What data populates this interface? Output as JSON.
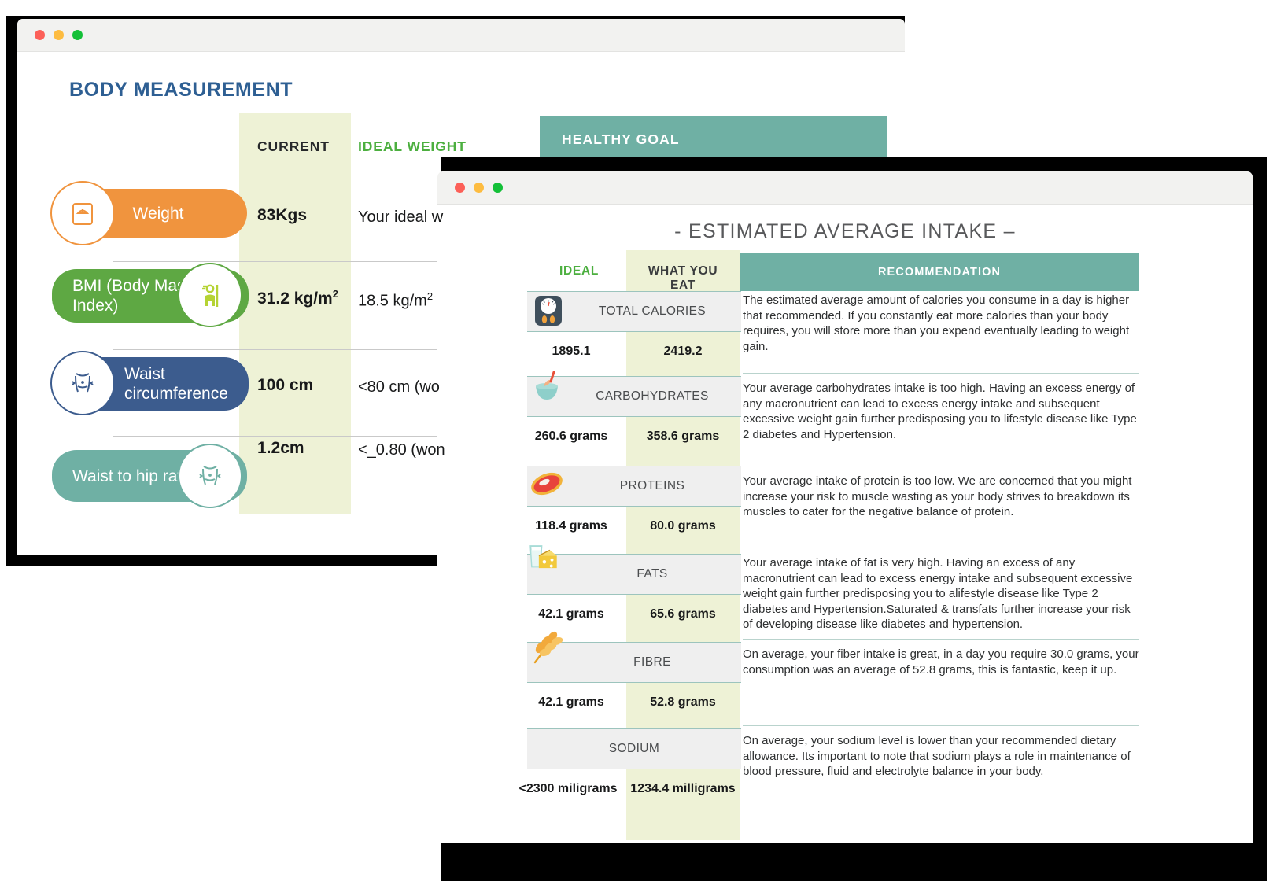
{
  "window1": {
    "traffic_lights": [
      "close",
      "minimize",
      "maximize"
    ],
    "title": "BODY MEASUREMENT",
    "columns": {
      "current": "CURRENT",
      "ideal_weight": "IDEAL WEIGHT",
      "healthy_goal": "HEALTHY GOAL"
    },
    "colors": {
      "title": "#2e5f93",
      "current_strip": "#eef2d6",
      "ideal_header": "#4caf3f",
      "healthy_goal_bar": "#6fb0a4"
    },
    "rows": [
      {
        "label": "Weight",
        "icon": "weighing-scale-icon",
        "pill_color": "#f0943e",
        "current": "83Kgs",
        "ideal": "Your ideal w"
      },
      {
        "label": "BMI (Body Mass Index)",
        "icon": "body-height-person-icon",
        "pill_color": "#5ea843",
        "current": "31.2 kg/m",
        "current_sup": "2",
        "ideal": "18.5 kg/m",
        "ideal_sup": "2-"
      },
      {
        "label": "Waist circumference",
        "icon": "waist-measure-icon",
        "pill_color": "#3c5c8e",
        "current": "100 cm",
        "ideal": "<80 cm (wo"
      },
      {
        "label": "Waist to hip ratio",
        "icon": "waist-hip-icon",
        "pill_color": "#6fb0a4",
        "current": "1.2cm",
        "ideal": "<_0.80 (won"
      }
    ]
  },
  "window2": {
    "traffic_lights": [
      "close",
      "minimize",
      "maximize"
    ],
    "title": "- ESTIMATED AVERAGE INTAKE –",
    "columns": {
      "ideal": "IDEAL",
      "what_you_eat": "WHAT YOU EAT",
      "recommendation": "RECOMMENDATION"
    },
    "colors": {
      "eat_strip": "#eef2d6",
      "recommendation_bar": "#6fb0a4",
      "ideal_header": "#4caf3f",
      "row_border": "#9cc4bd",
      "row_fill": "#efefef"
    },
    "rows": [
      {
        "name": "TOTAL CALORIES",
        "icon": "bathroom-scale-icon",
        "ideal": "1895.1",
        "eat": "2419.2",
        "recommendation": "The estimated average amount of calories you consume in a day is higher that recommended. If you constantly eat more calories than your body requires, you will store more than you expend eventually leading to weight gain."
      },
      {
        "name": "CARBOHYDRATES",
        "icon": "rice-bowl-icon",
        "ideal": "260.6 grams",
        "eat": "358.6 grams",
        "recommendation": "Your average carbohydrates intake is too high. Having an excess energy of any macronutrient can lead to excess energy intake and subsequent excessive weight gain further predisposing you to lifestyle disease like Type 2 diabetes and Hypertension."
      },
      {
        "name": "PROTEINS",
        "icon": "steak-meat-icon",
        "ideal": "118.4 grams",
        "eat": "80.0 grams",
        "recommendation": "Your average intake of protein is too low. We are concerned that you might increase your risk to muscle wasting as your body strives to breakdown its muscles to cater for the negative balance of protein."
      },
      {
        "name": "FATS",
        "icon": "milk-cheese-icon",
        "ideal": "42.1 grams",
        "eat": "65.6 grams",
        "recommendation": "Your average intake of fat is very high. Having an excess of any macronutrient can lead to excess energy  intake and subsequent excessive weight gain further predisposing you to alifestyle disease like Type 2 diabetes and Hypertension.Saturated & transfats further increase your risk of developing disease like diabetes and hypertension."
      },
      {
        "name": "FIBRE",
        "icon": "wheat-grain-icon",
        "ideal": "42.1 grams",
        "eat": "52.8 grams",
        "recommendation": "On average, your fiber intake is great, in a day you require 30.0 grams, your consumption was an average of 52.8 grams, this is fantastic, keep it up."
      },
      {
        "name": "SODIUM",
        "icon": "none",
        "ideal": "<2300 miligrams",
        "eat": "1234.4 milligrams",
        "recommendation": "On average, your sodium level is lower than your recommended dietary allowance. Its important to note that sodium plays a role in maintenance of blood pressure, fluid and electrolyte balance in your body."
      }
    ]
  }
}
